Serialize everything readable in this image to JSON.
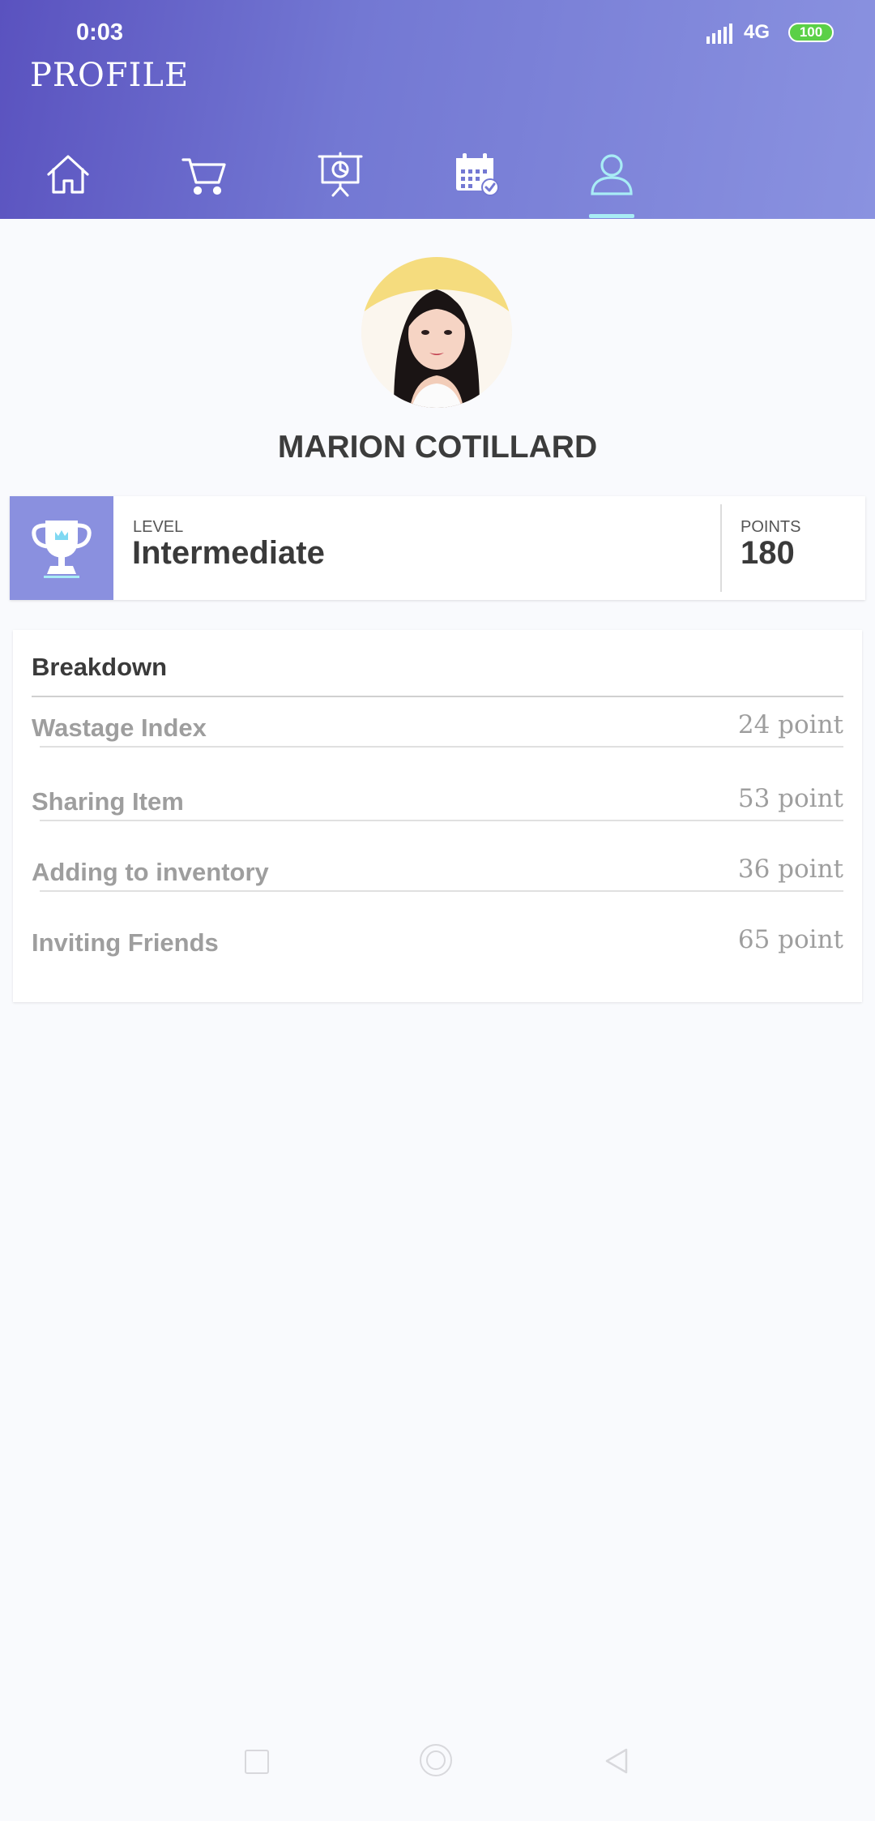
{
  "status_bar": {
    "time": "0:03",
    "network": "4G",
    "battery": "100"
  },
  "header": {
    "title": "PROFILE"
  },
  "tabs": [
    {
      "name": "home",
      "icon": "home-icon",
      "active": false
    },
    {
      "name": "cart",
      "icon": "cart-icon",
      "active": false
    },
    {
      "name": "presentation",
      "icon": "presentation-chart-icon",
      "active": false
    },
    {
      "name": "calendar",
      "icon": "calendar-check-icon",
      "active": false
    },
    {
      "name": "profile",
      "icon": "user-icon",
      "active": true
    }
  ],
  "profile": {
    "name": "MARION COTILLARD"
  },
  "level_card": {
    "level_label": "LEVEL",
    "level_value": "Intermediate",
    "points_label": "POINTS",
    "points_value": "180"
  },
  "breakdown": {
    "title": "Breakdown",
    "items": [
      {
        "label": "Wastage Index",
        "value": "24 point"
      },
      {
        "label": "Sharing Item",
        "value": "53 point"
      },
      {
        "label": "Adding to inventory",
        "value": "36 point"
      },
      {
        "label": "Inviting Friends",
        "value": "65 point"
      }
    ]
  },
  "colors": {
    "header_start": "#5a52bf",
    "header_end": "#8a92e0",
    "active_tab": "#a8ecf5",
    "level_badge_bg": "#8a90df",
    "battery": "#5bd047"
  }
}
